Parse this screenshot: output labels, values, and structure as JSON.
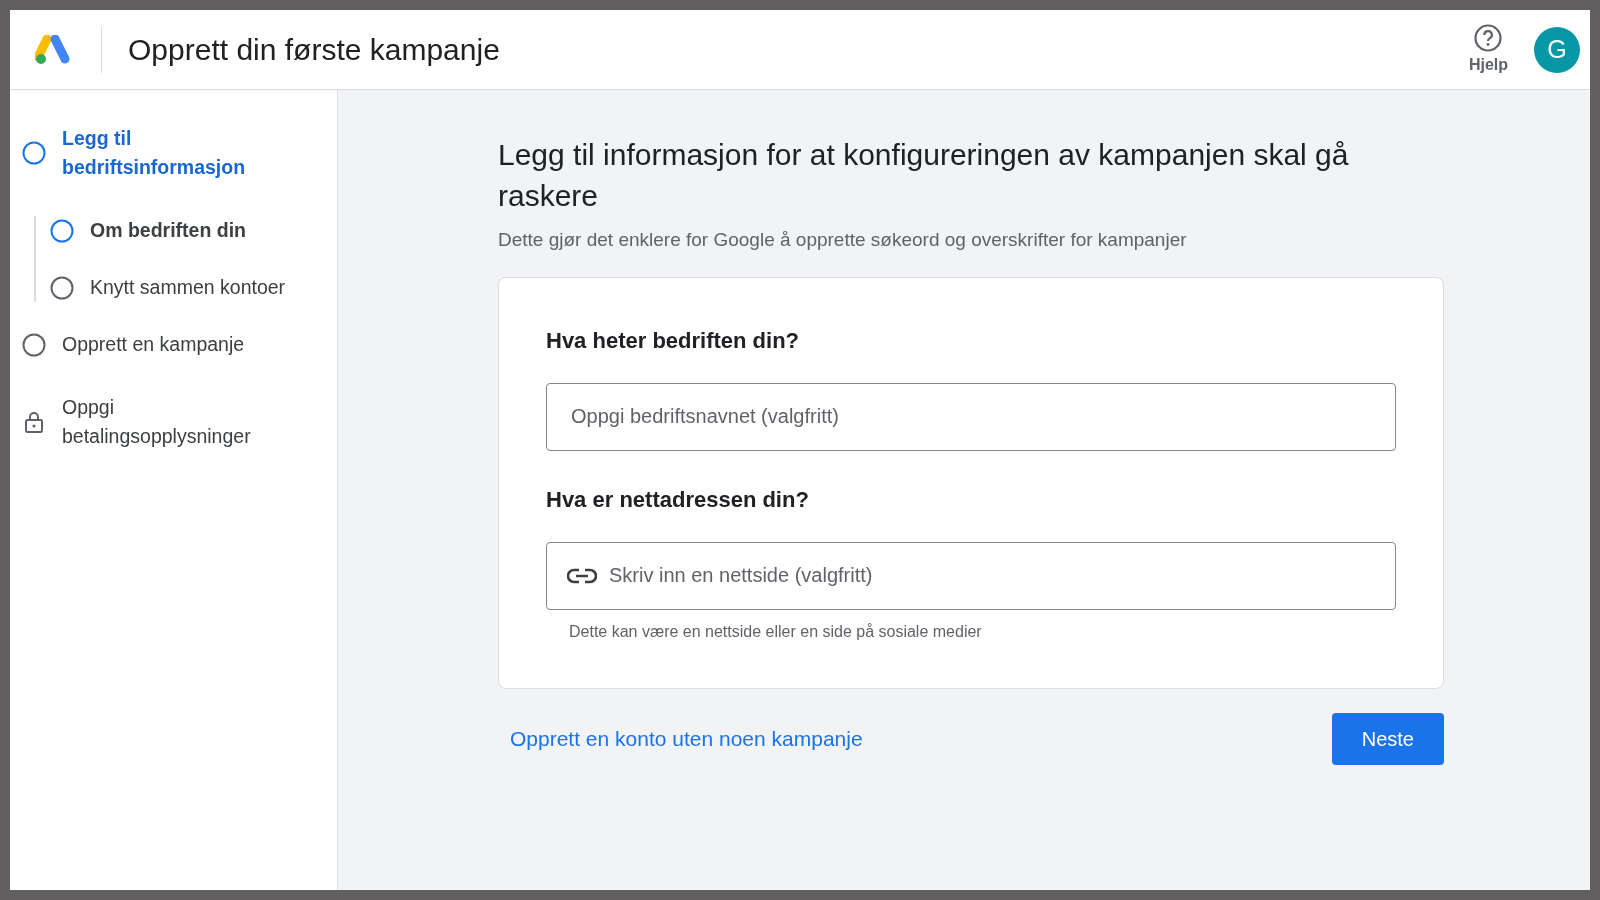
{
  "header": {
    "title": "Opprett din første kampanje",
    "help_label": "Hjelp",
    "avatar_letter": "G"
  },
  "steps": [
    {
      "label": "Legg til bedriftsinformasjon",
      "kind": "circle",
      "selected": true,
      "children": [
        {
          "label": "Om bedriften din",
          "kind": "circle",
          "selected": true
        },
        {
          "label": "Knytt sammen kontoer",
          "kind": "circle",
          "selected": false
        }
      ]
    },
    {
      "label": "Opprett en kampanje",
      "kind": "circle",
      "selected": false
    },
    {
      "label": "Oppgi betalingsopplysninger",
      "kind": "lock",
      "selected": false
    }
  ],
  "main": {
    "heading": "Legg til informasjon for at konfigureringen av kampanjen skal gå raskere",
    "subtitle": "Dette gjør det enklere for Google å opprette søkeord og overskrifter for kampanjer",
    "fields": [
      {
        "question": "Hva heter bedriften din?",
        "placeholder": "Oppgi bedriftsnavnet (valgfritt)",
        "kind": "text"
      },
      {
        "question": "Hva er nettadressen din?",
        "placeholder": "Skriv inn en nettside (valgfritt)",
        "kind": "link",
        "helper": "Dette kan være en nettside eller en side på sosiale medier"
      }
    ],
    "link": "Opprett en konto uten noen kampanje",
    "next_button": "Neste"
  }
}
